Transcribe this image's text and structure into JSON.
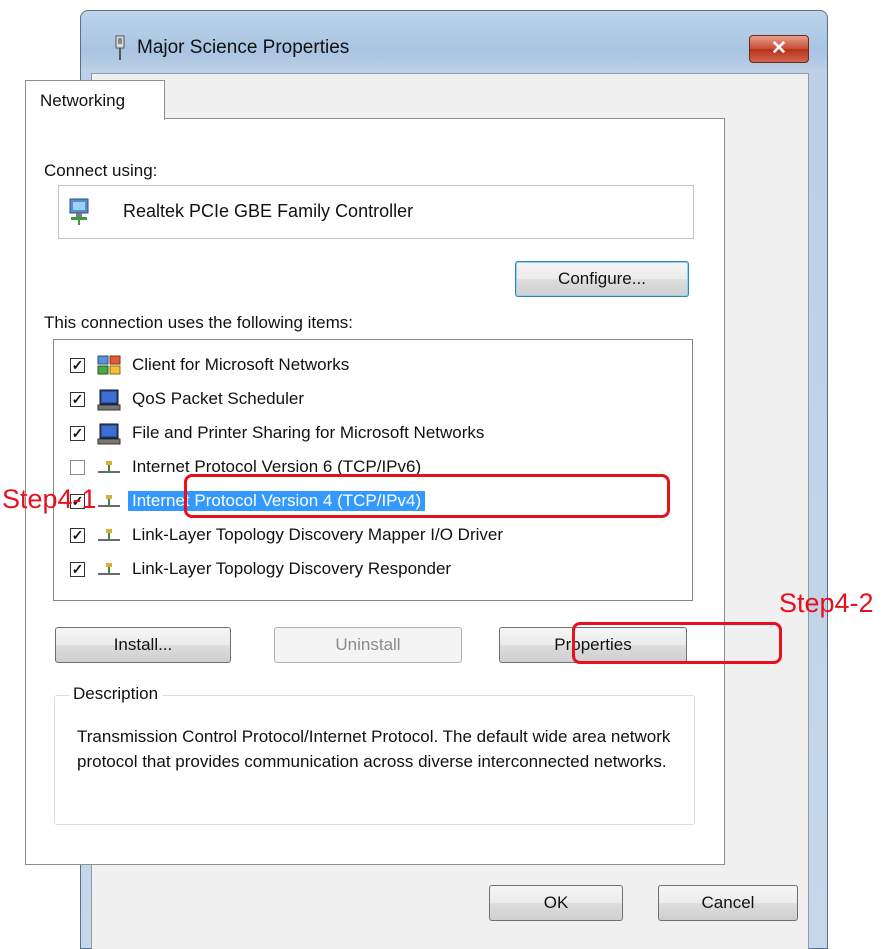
{
  "window": {
    "title": "Major Science Properties",
    "close_label": "✕"
  },
  "tabs": [
    {
      "label": "Networking"
    }
  ],
  "connect_using": {
    "label": "Connect using:",
    "adapter_name": "Realtek PCIe GBE Family Controller",
    "configure_label": "Configure..."
  },
  "items_section": {
    "label": "This connection uses the following items:",
    "items": [
      {
        "label": "Client for Microsoft Networks",
        "checked": true,
        "icon": "network-client-icon"
      },
      {
        "label": "QoS Packet Scheduler",
        "checked": true,
        "icon": "computer-monitor-icon"
      },
      {
        "label": "File and Printer Sharing for Microsoft Networks",
        "checked": true,
        "icon": "computer-monitor-icon"
      },
      {
        "label": "Internet Protocol Version 6 (TCP/IPv6)",
        "checked": false,
        "icon": "protocol-icon"
      },
      {
        "label": "Internet Protocol Version 4 (TCP/IPv4)",
        "checked": true,
        "icon": "protocol-icon",
        "selected": true
      },
      {
        "label": "Link-Layer Topology Discovery Mapper I/O Driver",
        "checked": true,
        "icon": "protocol-icon"
      },
      {
        "label": "Link-Layer Topology Discovery Responder",
        "checked": true,
        "icon": "protocol-icon"
      }
    ],
    "check_mark": "✓"
  },
  "buttons": {
    "install": "Install...",
    "uninstall": "Uninstall",
    "properties": "Properties",
    "ok": "OK",
    "cancel": "Cancel"
  },
  "description": {
    "legend": "Description",
    "text": "Transmission Control Protocol/Internet Protocol. The default wide area network protocol that provides communication across diverse interconnected networks."
  },
  "annotations": {
    "step1": "Step4-1",
    "step2": "Step4-2",
    "color": "#e8101f"
  },
  "colors": {
    "selection": "#3399ff",
    "close_button": "#c74a33"
  }
}
